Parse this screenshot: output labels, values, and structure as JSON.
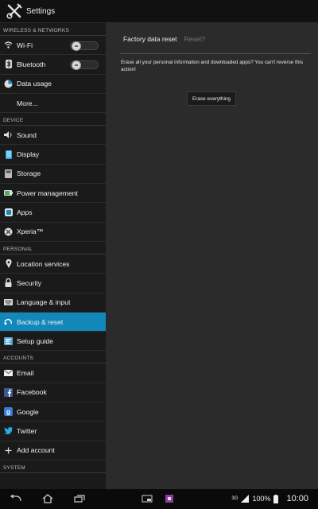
{
  "titlebar": {
    "title": "Settings"
  },
  "sidebar": {
    "sections": [
      {
        "header": "WIRELESS & NETWORKS",
        "items": [
          {
            "label": "Wi-Fi",
            "icon": "wifi-icon",
            "toggle": true
          },
          {
            "label": "Bluetooth",
            "icon": "bluetooth-icon",
            "toggle": true
          },
          {
            "label": "Data usage",
            "icon": "data-usage-icon"
          },
          {
            "label": "More...",
            "icon": ""
          }
        ]
      },
      {
        "header": "DEVICE",
        "items": [
          {
            "label": "Sound",
            "icon": "speaker-icon"
          },
          {
            "label": "Display",
            "icon": "display-icon"
          },
          {
            "label": "Storage",
            "icon": "storage-icon"
          },
          {
            "label": "Power management",
            "icon": "battery-icon"
          },
          {
            "label": "Apps",
            "icon": "apps-icon"
          },
          {
            "label": "Xperia™",
            "icon": "xperia-icon"
          }
        ]
      },
      {
        "header": "PERSONAL",
        "items": [
          {
            "label": "Location services",
            "icon": "location-icon"
          },
          {
            "label": "Security",
            "icon": "lock-icon"
          },
          {
            "label": "Language & input",
            "icon": "keyboard-icon"
          },
          {
            "label": "Backup & reset",
            "icon": "backup-icon",
            "active": true
          },
          {
            "label": "Setup guide",
            "icon": "setup-guide-icon"
          }
        ]
      },
      {
        "header": "ACCOUNTS",
        "items": [
          {
            "label": "Email",
            "icon": "email-icon"
          },
          {
            "label": "Facebook",
            "icon": "facebook-icon"
          },
          {
            "label": "Google",
            "icon": "google-icon"
          },
          {
            "label": "Twitter",
            "icon": "twitter-icon"
          },
          {
            "label": "Add account",
            "icon": "plus-icon"
          }
        ]
      },
      {
        "header": "SYSTEM",
        "items": []
      }
    ]
  },
  "main": {
    "crumb_primary": "Factory data reset",
    "crumb_secondary": "Reset?",
    "warning": "Erase all your personal information and downloaded apps? You can't reverse this action!",
    "button": "Erase everything"
  },
  "statusbar": {
    "signal": "3G",
    "battery": "100%",
    "time": "10:00"
  },
  "colors": {
    "accent": "#1188b9",
    "panel": "#2b2b2b",
    "sidebar": "#1a1a1a"
  }
}
